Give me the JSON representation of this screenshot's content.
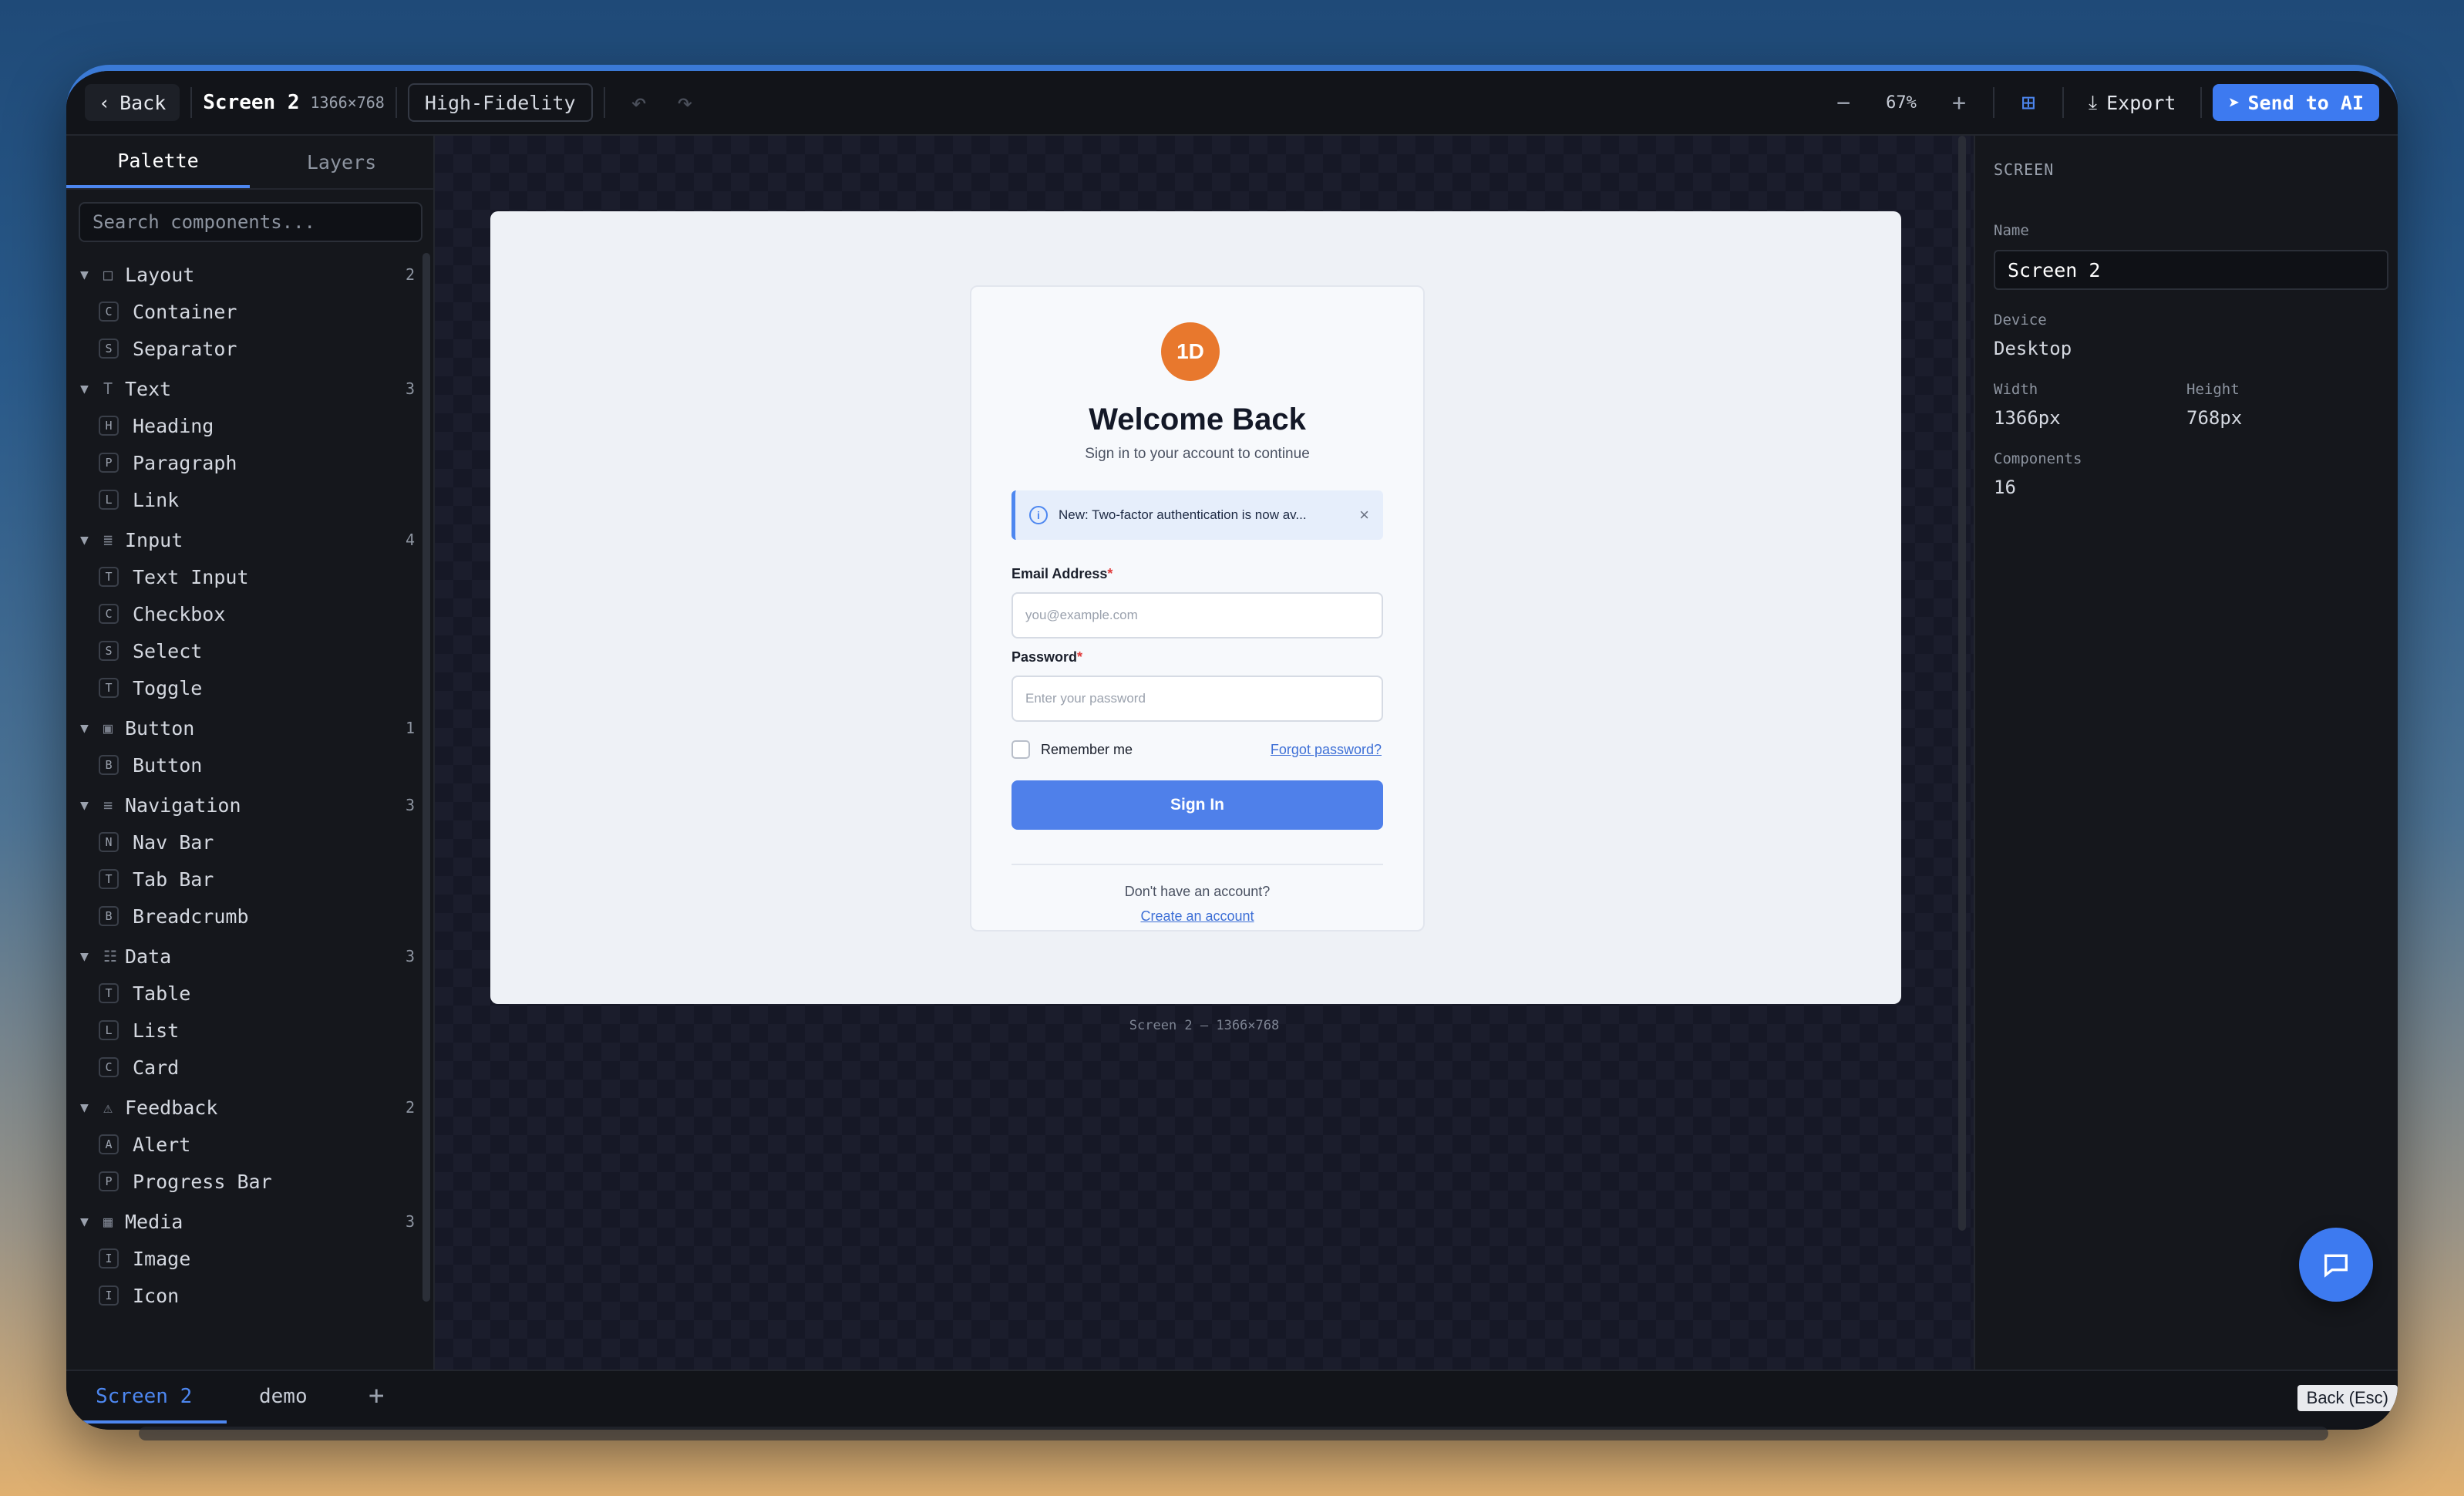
{
  "topbar": {
    "back_label": "Back",
    "screen_title": "Screen 2",
    "screen_dims": "1366×768",
    "fidelity": "High-Fidelity",
    "zoom": "67%",
    "export_label": "Export",
    "send_label": "Send to AI"
  },
  "left_panel": {
    "tabs": [
      "Palette",
      "Layers"
    ],
    "search_placeholder": "Search components...",
    "categories": [
      {
        "name": "Layout",
        "icon": "□",
        "count": "2",
        "items": [
          {
            "badge": "C",
            "label": "Container"
          },
          {
            "badge": "S",
            "label": "Separator"
          }
        ]
      },
      {
        "name": "Text",
        "icon": "T",
        "count": "3",
        "items": [
          {
            "badge": "H",
            "label": "Heading"
          },
          {
            "badge": "P",
            "label": "Paragraph"
          },
          {
            "badge": "L",
            "label": "Link"
          }
        ]
      },
      {
        "name": "Input",
        "icon": "≣",
        "count": "4",
        "items": [
          {
            "badge": "T",
            "label": "Text Input"
          },
          {
            "badge": "C",
            "label": "Checkbox"
          },
          {
            "badge": "S",
            "label": "Select"
          },
          {
            "badge": "T",
            "label": "Toggle"
          }
        ]
      },
      {
        "name": "Button",
        "icon": "▣",
        "count": "1",
        "items": [
          {
            "badge": "B",
            "label": "Button"
          }
        ]
      },
      {
        "name": "Navigation",
        "icon": "≡",
        "count": "3",
        "items": [
          {
            "badge": "N",
            "label": "Nav Bar"
          },
          {
            "badge": "T",
            "label": "Tab Bar"
          },
          {
            "badge": "B",
            "label": "Breadcrumb"
          }
        ]
      },
      {
        "name": "Data",
        "icon": "☷",
        "count": "3",
        "items": [
          {
            "badge": "T",
            "label": "Table"
          },
          {
            "badge": "L",
            "label": "List"
          },
          {
            "badge": "C",
            "label": "Card"
          }
        ]
      },
      {
        "name": "Feedback",
        "icon": "⚠",
        "count": "2",
        "items": [
          {
            "badge": "A",
            "label": "Alert"
          },
          {
            "badge": "P",
            "label": "Progress Bar"
          }
        ]
      },
      {
        "name": "Media",
        "icon": "▦",
        "count": "3",
        "items": [
          {
            "badge": "I",
            "label": "Image"
          },
          {
            "badge": "I",
            "label": "Icon"
          }
        ]
      }
    ]
  },
  "canvas": {
    "caption": "Screen 2 — 1366×768",
    "login": {
      "avatar_text": "1D",
      "title": "Welcome Back",
      "subtitle": "Sign in to your account to continue",
      "alert_text": "New: Two-factor authentication is now av...",
      "email_label": "Email Address",
      "email_placeholder": "you@example.com",
      "password_label": "Password",
      "password_placeholder": "Enter your password",
      "required_mark": "*",
      "remember_label": "Remember me",
      "forgot_label": "Forgot password?",
      "signin_label": "Sign In",
      "no_account": "Don't have an account?",
      "create_label": "Create an account"
    }
  },
  "right_panel": {
    "section": "SCREEN",
    "name_label": "Name",
    "name_value": "Screen 2",
    "device_label": "Device",
    "device_value": "Desktop",
    "width_label": "Width",
    "width_value": "1366px",
    "height_label": "Height",
    "height_value": "768px",
    "components_label": "Components",
    "components_value": "16"
  },
  "bottombar": {
    "tabs": [
      "Screen 2",
      "demo"
    ],
    "add_label": "+",
    "esc_tip": "Back (Esc)"
  }
}
